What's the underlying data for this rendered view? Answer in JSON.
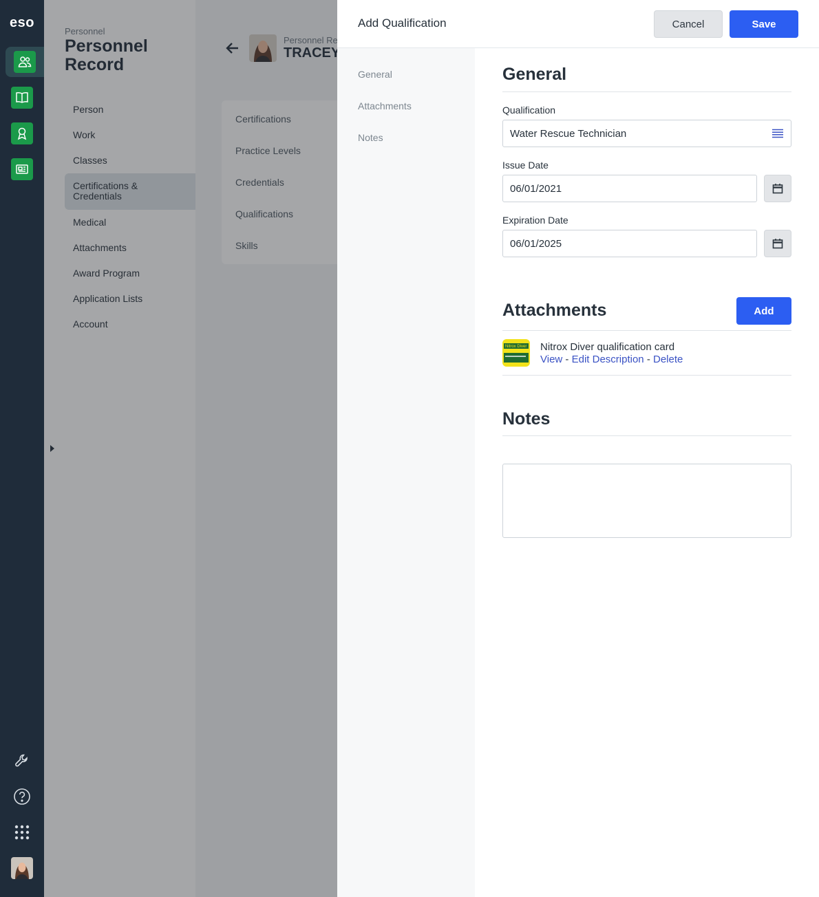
{
  "rail": {
    "logo": "eso",
    "apps": [
      "people-icon",
      "book-icon",
      "award-icon",
      "news-icon"
    ],
    "bottom": [
      "wrench-icon",
      "help-icon",
      "apps-grid-icon"
    ],
    "accent": "#1b9a4a"
  },
  "background": {
    "eyebrow": "Personnel",
    "title": "Personnel Record",
    "nav": [
      "Person",
      "Work",
      "Classes",
      "Certifications & Credentials",
      "Medical",
      "Attachments",
      "Award Program",
      "Application Lists",
      "Account"
    ],
    "nav_active": "Certifications & Credentials",
    "record_label": "Personnel Rec",
    "record_name": "TRACEY",
    "card_items": [
      "Certifications",
      "Practice Levels",
      "Credentials",
      "Qualifications",
      "Skills"
    ]
  },
  "drawer": {
    "title": "Add Qualification",
    "cancel_label": "Cancel",
    "save_label": "Save",
    "side_nav": [
      "General",
      "Attachments",
      "Notes"
    ],
    "general": {
      "heading": "General",
      "qualification_label": "Qualification",
      "qualification_value": "Water Rescue Technician",
      "issue_label": "Issue Date",
      "issue_value": "06/01/2021",
      "expiration_label": "Expiration Date",
      "expiration_value": "06/01/2025"
    },
    "attachments": {
      "heading": "Attachments",
      "add_label": "Add",
      "items": [
        {
          "title": "Nitrox Diver qualification card",
          "view": "View",
          "edit": "Edit Description",
          "delete": "Delete",
          "sep": "-",
          "thumb_text": "Nitrox Diver"
        }
      ]
    },
    "notes": {
      "heading": "Notes",
      "value": ""
    }
  },
  "colors": {
    "primary": "#2c5ef2",
    "link": "#3a52c4",
    "text": "#27313b"
  }
}
